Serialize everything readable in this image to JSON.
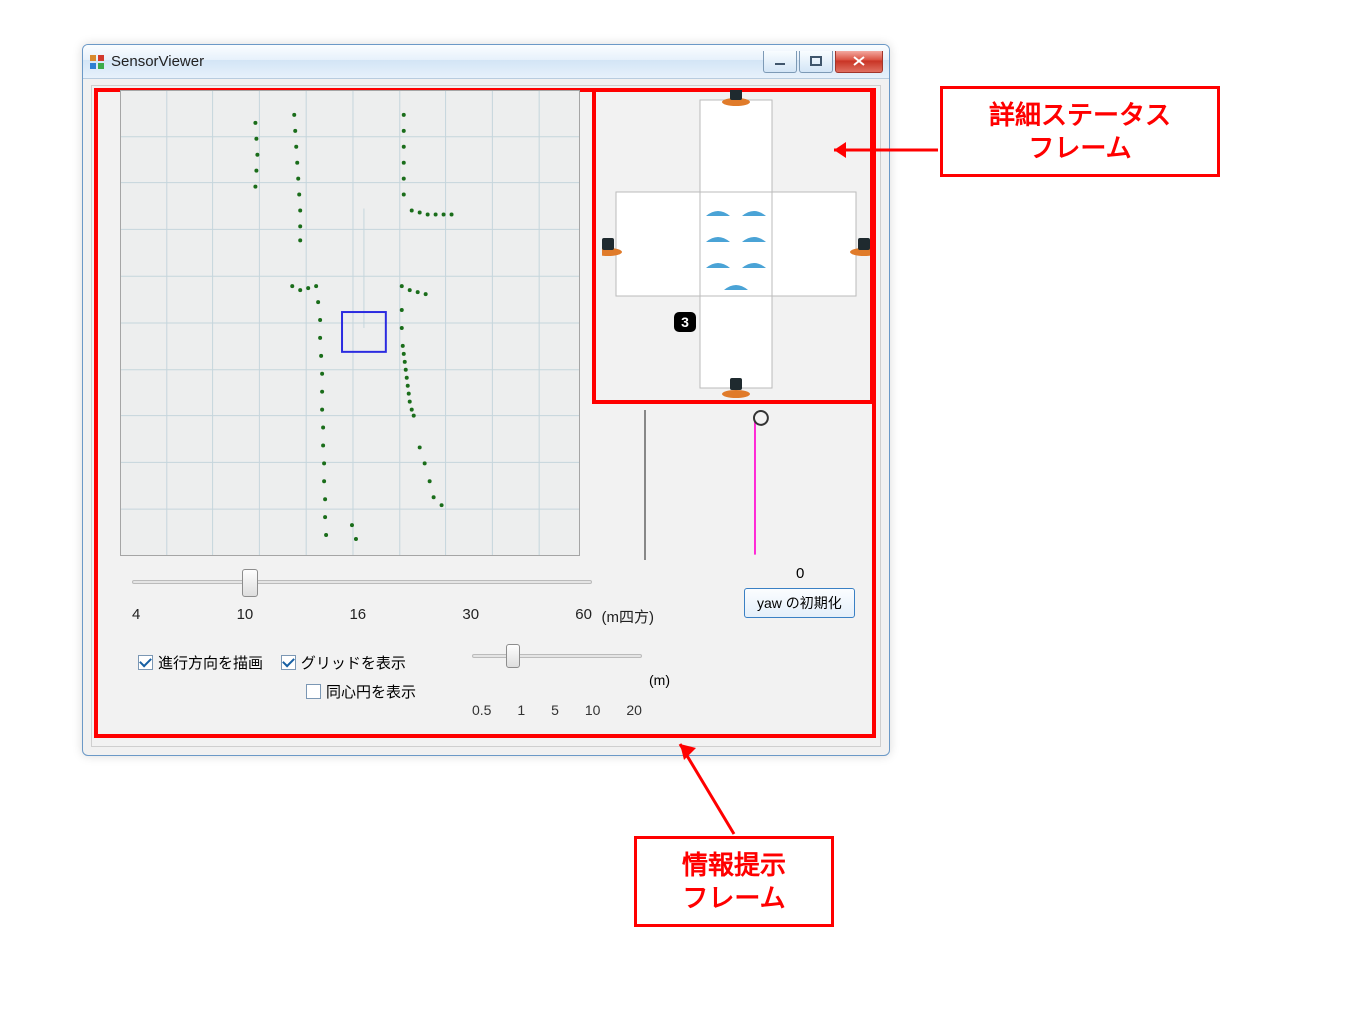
{
  "window": {
    "title": "SensorViewer"
  },
  "map": {
    "slider_ticks": [
      "4",
      "10",
      "16",
      "30",
      "60"
    ],
    "slider_unit": "(m四方)",
    "check_direction": "進行方向を描画",
    "check_grid": "グリッドを表示",
    "check_circles": "同心円を表示",
    "small_slider_ticks": [
      "0.5",
      "1",
      "5",
      "10",
      "20"
    ],
    "small_slider_unit": "(m)"
  },
  "status": {
    "label_number": "3"
  },
  "yaw": {
    "value": "0",
    "button": "yaw の初期化"
  },
  "callouts": {
    "status_frame_line1": "詳細ステータス",
    "status_frame_line2": "フレーム",
    "info_frame_line1": "情報提示",
    "info_frame_line2": "フレーム"
  }
}
